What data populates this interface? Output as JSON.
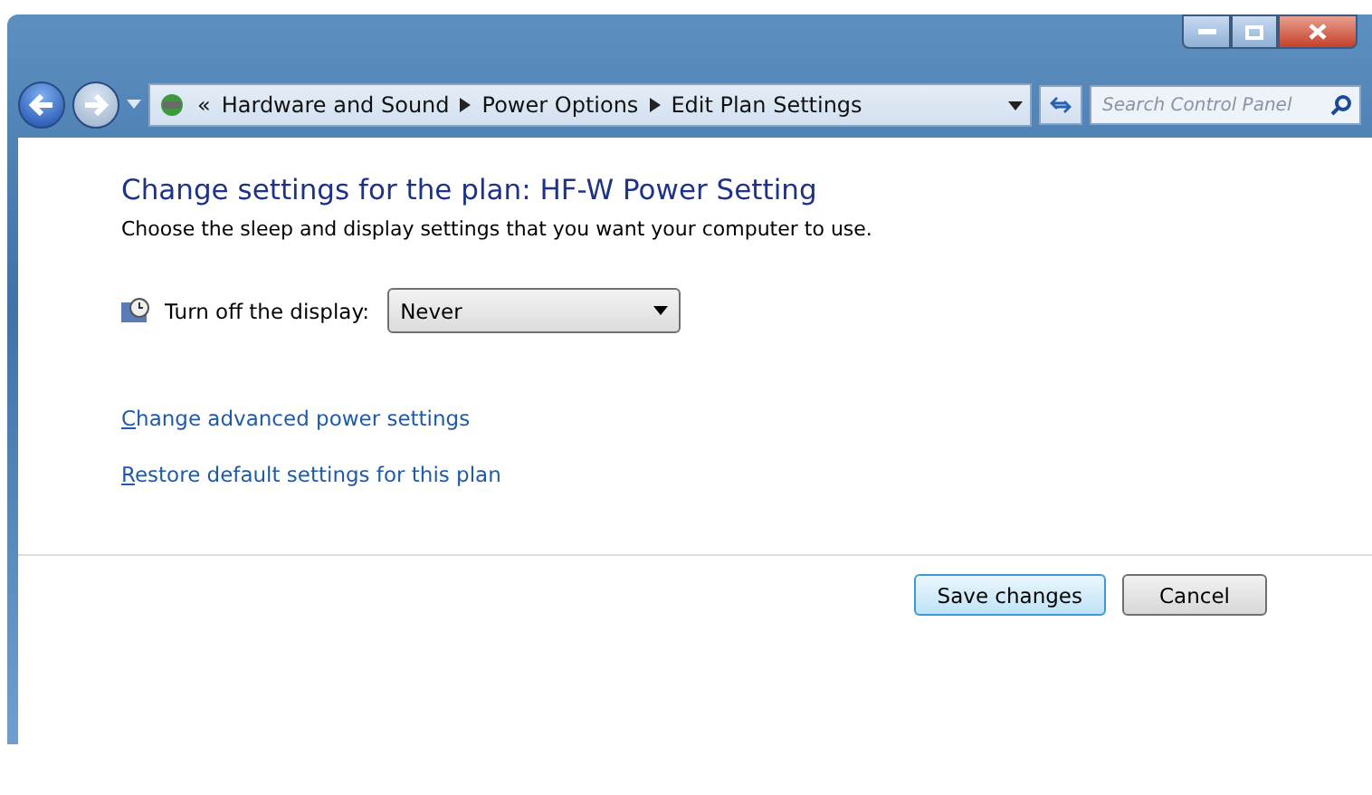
{
  "address_bar": {
    "overflow": "«",
    "crumbs": [
      "Hardware and Sound",
      "Power Options",
      "Edit Plan Settings"
    ]
  },
  "search": {
    "placeholder": "Search Control Panel"
  },
  "heading": "Change settings for the plan: HF-W Power Setting",
  "subheading": "Choose the sleep and display settings that you want your computer to use.",
  "settings": [
    {
      "label": "Turn off the display:",
      "value": "Never"
    }
  ],
  "links": [
    "Change advanced power settings",
    "Restore default settings for this plan"
  ],
  "buttons": [
    {
      "label": "Save changes",
      "default": true
    },
    {
      "label": "Cancel",
      "default": false
    }
  ]
}
